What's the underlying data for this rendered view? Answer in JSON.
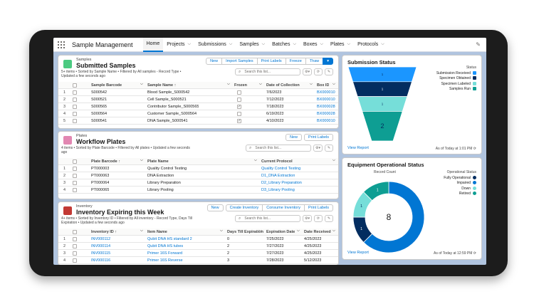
{
  "app": {
    "title": "Sample Management"
  },
  "nav": [
    {
      "label": "Home",
      "chev": false,
      "active": true
    },
    {
      "label": "Projects",
      "chev": true
    },
    {
      "label": "Submissions",
      "chev": true
    },
    {
      "label": "Samples",
      "chev": true
    },
    {
      "label": "Batches",
      "chev": true
    },
    {
      "label": "Boxes",
      "chev": true
    },
    {
      "label": "Plates",
      "chev": true
    },
    {
      "label": "Protocols",
      "chev": true
    }
  ],
  "search_placeholder": "Search this list...",
  "samples": {
    "object": "Samples",
    "title": "Submitted Samples",
    "meta1": "5+ items • Sorted by Sample Name • Filtered by All samples - Record Type •",
    "meta2": "Updated a few seconds ago",
    "buttons": [
      "New",
      "Import Samples",
      "Print Labels",
      "Freeze",
      "Thaw"
    ],
    "headers": [
      "Sample Barcode",
      "Sample Name ↑",
      "Frozen",
      "Date of Collection",
      "Box ID"
    ],
    "rows": [
      [
        "1",
        "S000542",
        "Blood Sample_S000542",
        false,
        "7/6/2023",
        "BX000010"
      ],
      [
        "2",
        "S000521",
        "Cell Sample_S000521",
        false,
        "7/12/2023",
        "BX000010"
      ],
      [
        "3",
        "S000565",
        "Contributor Sample_S000565",
        true,
        "7/18/2023",
        "BX000028"
      ],
      [
        "4",
        "S000564",
        "Customer Sample_S000564",
        false,
        "6/19/2023",
        "BX000028"
      ],
      [
        "5",
        "S000541",
        "DNA Sample_S000541",
        true,
        "4/10/2023",
        "BX000010"
      ]
    ]
  },
  "plates": {
    "object": "Plates",
    "title": "Workflow Plates",
    "meta1": "4 items • Sorted by Plate Barcode • Filtered by All plates • Updated a few seconds",
    "meta2": "ago",
    "buttons": [
      "New",
      "Print Labels"
    ],
    "headers": [
      "Plate Barcode ↑",
      "Plate Name",
      "Current Protocol"
    ],
    "rows": [
      [
        "1",
        "PT000003",
        "Quality Control Testing",
        "Quality Control Testing"
      ],
      [
        "2",
        "PT000063",
        "DNA Extraction",
        "D1_DNA Extraction"
      ],
      [
        "3",
        "PT000064",
        "Library Preparation",
        "D2_Library Preparation"
      ],
      [
        "4",
        "PT000065",
        "Library Pooling",
        "D3_Library Pooling"
      ]
    ]
  },
  "inventory": {
    "object": "Inventory",
    "title": "Inventory Expiring this Week",
    "meta1": "4+ items • Sorted by Inventory ID • Filtered by All inventory - Record Type, Days Till",
    "meta2": "Expiration • Updated a few seconds ago",
    "buttons": [
      "New",
      "Create Inventory",
      "Consume Inventory",
      "Print Labels"
    ],
    "headers": [
      "Inventory ID ↑",
      "Item Name",
      "Days Till Expiration",
      "Expiration Date",
      "Date Received"
    ],
    "rows": [
      [
        "1",
        "INV000112",
        "Qubit DNA HS standard 2",
        "0",
        "7/25/2023",
        "4/25/2023"
      ],
      [
        "2",
        "INV000114",
        "Qubit DNA HS tubes",
        "2",
        "7/27/2023",
        "4/25/2023"
      ],
      [
        "3",
        "INV000115",
        "Primer 16S Forward",
        "2",
        "7/27/2023",
        "4/25/2023"
      ],
      [
        "4",
        "INV000116",
        "Primer 16S Reverse",
        "3",
        "7/28/2023",
        "5/12/2023"
      ]
    ]
  },
  "submission": {
    "title": "Submission Status",
    "legend_title": "Status",
    "legend": [
      {
        "label": "Submission Received",
        "color": "#1b96ff"
      },
      {
        "label": "Specimen Obtained",
        "color": "#032d60"
      },
      {
        "label": "Specimen Labeled",
        "color": "#76ded9"
      },
      {
        "label": "Samples Run",
        "color": "#0e9e93"
      }
    ],
    "funnel_labels": [
      "1",
      "1",
      "1",
      "2"
    ],
    "view": "View Report",
    "asof": "As of Today at 1:01 PM"
  },
  "equipment": {
    "title": "Equipment Operational Status",
    "subtitle": "Record Count",
    "legend_title": "Operational Status",
    "legend": [
      {
        "label": "Fully Operational",
        "color": "#032d60"
      },
      {
        "label": "Impaired",
        "color": "#0176d3"
      },
      {
        "label": "Down",
        "color": "#76ded9"
      },
      {
        "label": "Retired",
        "color": "#0e9e93"
      }
    ],
    "center": "8",
    "segment_labels": [
      "1",
      "3",
      "1",
      "1"
    ],
    "view": "View Report",
    "asof": "As of Today at 12:59 PM"
  },
  "chart_data": [
    {
      "type": "funnel",
      "title": "Submission Status",
      "categories": [
        "Submission Received",
        "Specimen Obtained",
        "Specimen Labeled",
        "Samples Run"
      ],
      "values": [
        1,
        1,
        1,
        2
      ],
      "colors": [
        "#1b96ff",
        "#032d60",
        "#76ded9",
        "#0e9e93"
      ]
    },
    {
      "type": "pie",
      "subtype": "donut",
      "title": "Equipment Operational Status",
      "total": 8,
      "slices": [
        {
          "name": "Impaired",
          "value": 5,
          "color": "#0176d3"
        },
        {
          "name": "Fully Operational",
          "value": 1,
          "color": "#032d60"
        },
        {
          "name": "Down",
          "value": 1,
          "color": "#76ded9"
        },
        {
          "name": "Retired",
          "value": 1,
          "color": "#0e9e93"
        }
      ],
      "labels": [
        {
          "text": "1",
          "slice": "Fully Operational"
        },
        {
          "text": "1",
          "slice": "Down"
        },
        {
          "text": "1",
          "slice": "Retired"
        }
      ]
    }
  ]
}
